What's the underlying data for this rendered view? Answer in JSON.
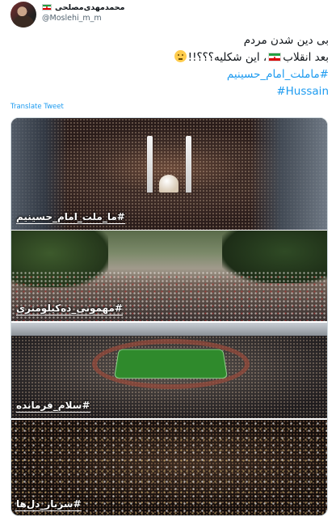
{
  "user": {
    "display_name": "محمدمهدی‌مصلحی",
    "handle": "@Moslehi_m_m",
    "flag_icon": "iran-flag-icon"
  },
  "tweet": {
    "lines": [
      "بی دین شدن مردم",
      "بعد انقلاب",
      "، این شکلیه؟؟؟!!",
      "#ماملت_امام_حسینیم",
      "#Hussain"
    ],
    "translate_label": "Translate Tweet"
  },
  "media": {
    "captions": [
      "#ما_ملت_امام_حسینیم",
      "#مهمونی_ده‌کیلومتری",
      "#سلام_فرمانده",
      "#سرباز_دل‌ها"
    ]
  },
  "colors": {
    "link": "#1d9bf0",
    "text": "#0f1419",
    "secondary": "#536471"
  }
}
